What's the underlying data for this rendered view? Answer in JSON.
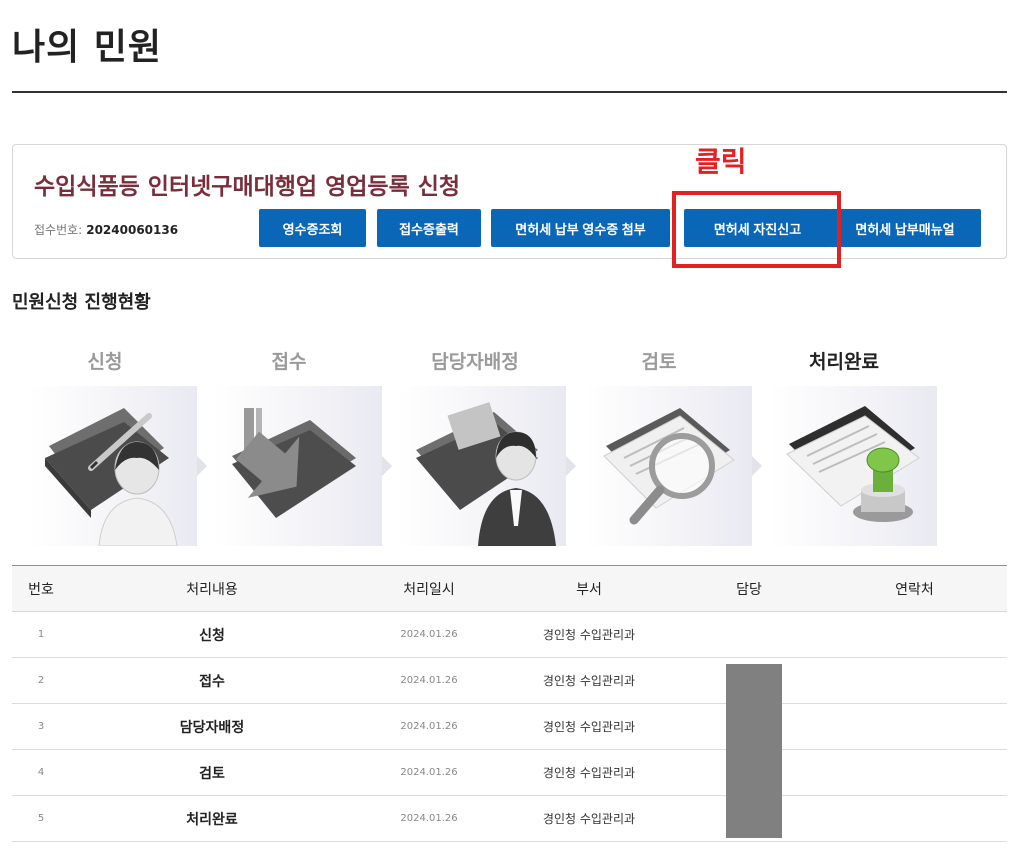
{
  "page": {
    "title": "나의 민원"
  },
  "application": {
    "title": "수입식품등 인터넷구매대행업 영업등록 신청",
    "receipt_label": "접수번호:",
    "receipt_number": "20240060136",
    "buttons": [
      {
        "label": "영수증조회"
      },
      {
        "label": "접수증출력"
      },
      {
        "label": "면허세 납부 영수증 첨부"
      },
      {
        "label": "면허세 자진신고"
      },
      {
        "label": "면허세 납부매뉴얼"
      }
    ]
  },
  "annotation": {
    "label": "클릭",
    "color": "#e22222"
  },
  "progress": {
    "title": "민원신청 진행현황",
    "steps": [
      {
        "label": "신청",
        "icon": "folder-pen-person-icon",
        "active": false
      },
      {
        "label": "접수",
        "icon": "folder-arrow-icon",
        "active": false
      },
      {
        "label": "담당자배정",
        "icon": "folder-person-icon",
        "active": false
      },
      {
        "label": "검토",
        "icon": "documents-magnifier-icon",
        "active": false
      },
      {
        "label": "처리완료",
        "icon": "documents-stamp-icon",
        "active": true
      }
    ]
  },
  "table": {
    "headers": {
      "no": "번호",
      "content": "처리내용",
      "date": "처리일시",
      "dept": "부서",
      "manager": "담당",
      "contact": "연락처"
    },
    "rows": [
      {
        "no": "1",
        "content": "신청",
        "date": "2024.01.26",
        "dept": "경인청 수입관리과"
      },
      {
        "no": "2",
        "content": "접수",
        "date": "2024.01.26",
        "dept": "경인청 수입관리과"
      },
      {
        "no": "3",
        "content": "담당자배정",
        "date": "2024.01.26",
        "dept": "경인청 수입관리과"
      },
      {
        "no": "4",
        "content": "검토",
        "date": "2024.01.26",
        "dept": "경인청 수입관리과"
      },
      {
        "no": "5",
        "content": "처리완료",
        "date": "2024.01.26",
        "dept": "경인청 수입관리과"
      }
    ]
  },
  "colors": {
    "primary_button": "#0a67b7",
    "app_title": "#7a2e3c",
    "highlight": "#e22222"
  }
}
